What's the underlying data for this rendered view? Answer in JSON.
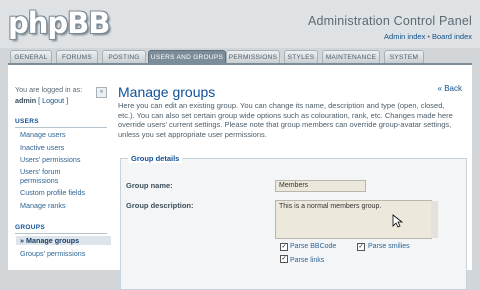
{
  "header": {
    "logo": "phpBB",
    "title": "Administration Control Panel",
    "links": [
      "Admin index",
      "Board index"
    ],
    "link_separator": "•"
  },
  "tabs": [
    {
      "label": "GENERAL",
      "active": false
    },
    {
      "label": "FORUMS",
      "active": false
    },
    {
      "label": "POSTING",
      "active": false
    },
    {
      "label": "USERS AND GROUPS",
      "active": true
    },
    {
      "label": "PERMISSIONS",
      "active": false
    },
    {
      "label": "STYLES",
      "active": false
    },
    {
      "label": "MAINTENANCE",
      "active": false
    },
    {
      "label": "SYSTEM",
      "active": false
    }
  ],
  "sidebar": {
    "logged_in_text": "You are logged in as:",
    "username": "admin",
    "logout": "[ Logout ]",
    "collapse_glyph": "«",
    "sections": [
      {
        "heading": "USERS",
        "items": [
          "Manage users",
          "Inactive users",
          "Users' permissions",
          "Users' forum permissions",
          "Custom profile fields",
          "Manage ranks"
        ]
      },
      {
        "heading": "GROUPS",
        "items": [
          "» Manage groups",
          "Groups' permissions"
        ]
      }
    ]
  },
  "main": {
    "title": "Manage groups",
    "back_link": "« Back",
    "description": "Here you can edit an existing group. You can change its name, description and type (open, closed, etc.). You can also set certain group wide options such as colouration, rank, etc. Changes made here override users' current settings. Please note that group members can override group-avatar settings, unless you set appropriate user permissions.",
    "fieldset_legend": "Group details",
    "group_name_label": "Group name:",
    "group_name_value": "Members",
    "group_desc_label": "Group description:",
    "group_desc_value": "This is a normal members group.",
    "options": [
      {
        "label": "Parse BBCode",
        "checked": true
      },
      {
        "label": "Parse smilies",
        "checked": true
      },
      {
        "label": "Parse links",
        "checked": true
      }
    ]
  },
  "colors": {
    "accent": "#115098",
    "active_tab": "#7b8d99",
    "link": "#2f6595",
    "background": "#d2d6d9"
  }
}
